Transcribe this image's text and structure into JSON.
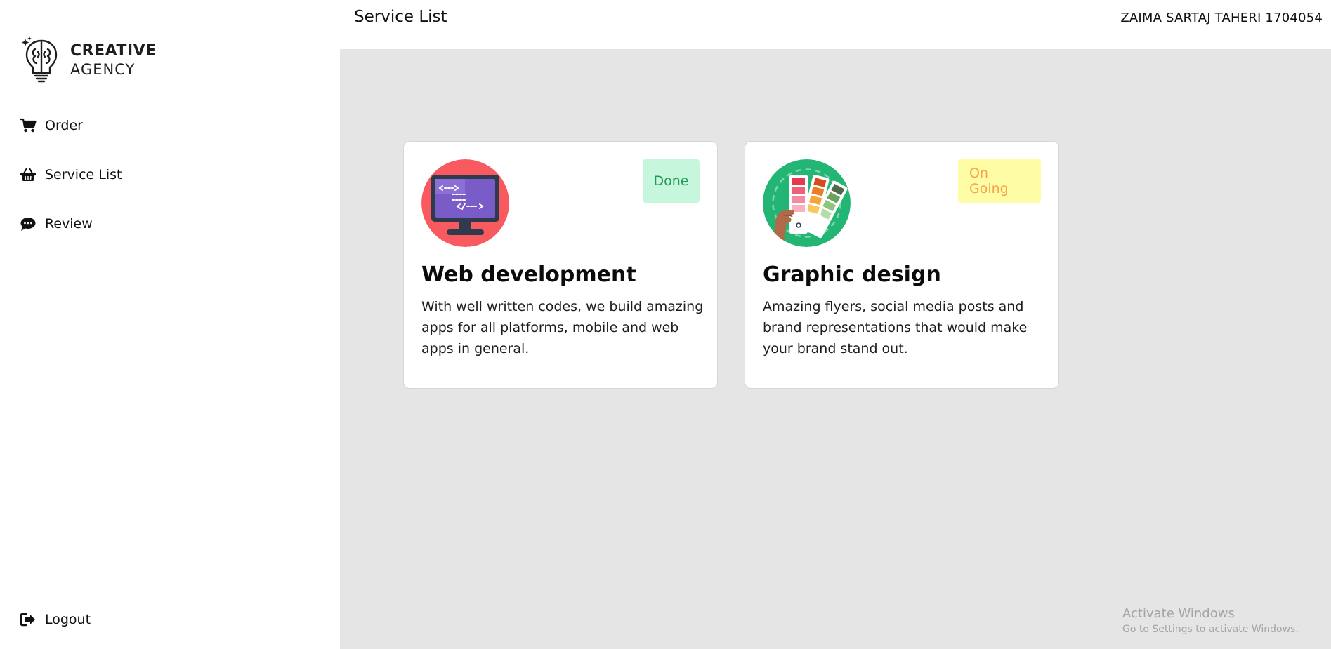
{
  "brand": {
    "line1": "CREATIVE",
    "line2": "AGENCY",
    "icon": "brain-bulb-icon"
  },
  "sidebar": {
    "items": [
      {
        "label": "Order",
        "icon": "cart-icon"
      },
      {
        "label": "Service List",
        "icon": "basket-icon"
      },
      {
        "label": "Review",
        "icon": "comment-icon"
      }
    ],
    "logout": {
      "label": "Logout",
      "icon": "sign-out-icon"
    }
  },
  "header": {
    "title": "Service List",
    "user": "ZAIMA SARTAJ TAHERI 1704054"
  },
  "services": [
    {
      "title": "Web development",
      "description": "With well written codes, we build amazing apps for all platforms, mobile and web apps in general.",
      "status": "Done",
      "status_bg": "#c6f6dc",
      "status_color": "#1f9a5a",
      "icon": "monitor-code-icon",
      "icon_bg": "#f85a5f"
    },
    {
      "title": "Graphic design",
      "description": "Amazing flyers, social media posts and brand representations that would make your brand stand out.",
      "status": "On Going",
      "status_bg": "#fefca4",
      "status_color": "#f7a24c",
      "icon": "color-palette-icon",
      "icon_bg": "#22b573"
    }
  ],
  "watermark": {
    "title": "Activate Windows",
    "subtitle": "Go to Settings to activate Windows."
  },
  "colors": {
    "main_bg": "#e5e5e5",
    "card_bg": "#ffffff"
  }
}
